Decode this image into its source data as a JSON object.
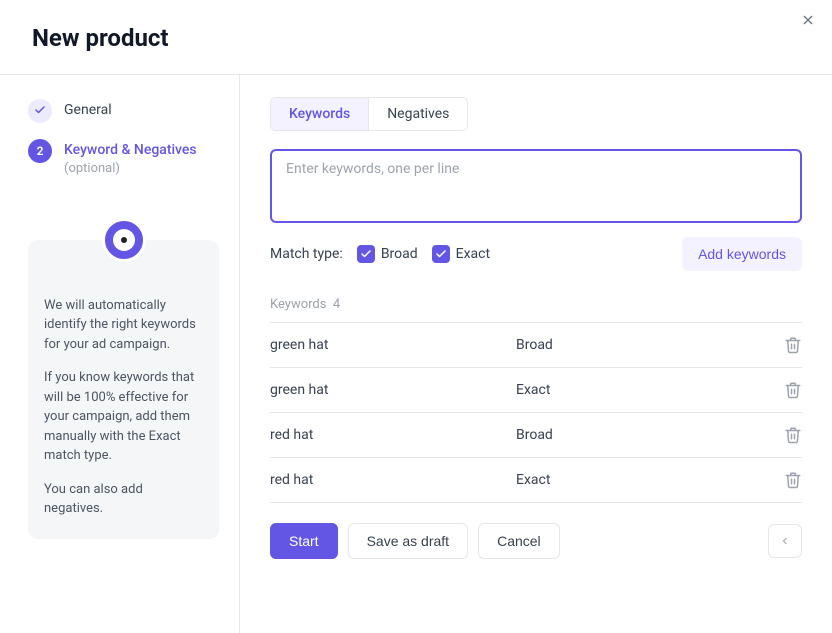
{
  "header": {
    "title": "New product"
  },
  "sidebar": {
    "steps": [
      {
        "label": "General",
        "status": "done"
      },
      {
        "label": "Keyword & Negatives",
        "sub": "(optional)",
        "status": "active",
        "number": "2"
      }
    ],
    "help": {
      "p1": "We will automatically identify the right keywords for your ad campaign.",
      "p2": "If you know keywords that will be 100% effective for your campaign, add them manually with the Exact match type.",
      "p3": "You can also add negatives."
    }
  },
  "main": {
    "tabs": [
      {
        "label": "Keywords",
        "active": true
      },
      {
        "label": "Negatives",
        "active": false
      }
    ],
    "input_placeholder": "Enter keywords, one per line",
    "match": {
      "label": "Match type:",
      "options": [
        {
          "label": "Broad",
          "checked": true
        },
        {
          "label": "Exact",
          "checked": true
        }
      ],
      "add_button": "Add keywords"
    },
    "list": {
      "header_label": "Keywords",
      "count": "4",
      "rows": [
        {
          "keyword": "green hat",
          "type": "Broad"
        },
        {
          "keyword": "green hat",
          "type": "Exact"
        },
        {
          "keyword": "red hat",
          "type": "Broad"
        },
        {
          "keyword": "red hat",
          "type": "Exact"
        }
      ]
    },
    "footer": {
      "start": "Start",
      "draft": "Save as draft",
      "cancel": "Cancel"
    }
  }
}
